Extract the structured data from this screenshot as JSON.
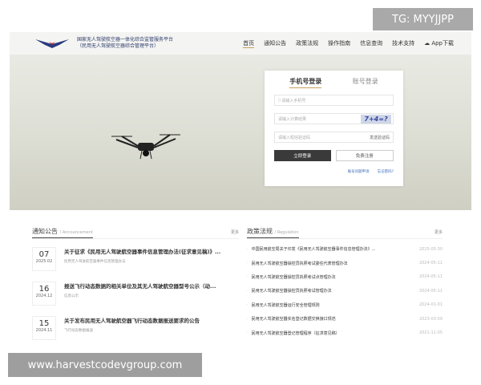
{
  "watermark_top": "TG: MYYJJPP",
  "watermark_bottom": "www.harvestcodevgroup.com",
  "header": {
    "title1": "国家无人驾驶航空器一体化综合监管服务平台",
    "title2": "（民用无人驾驶航空器综合管理平台）",
    "nav": [
      "首页",
      "通知公告",
      "政策法规",
      "操作指南",
      "信息查询",
      "技术支持",
      "App下载"
    ]
  },
  "login": {
    "tab_phone": "手机号登录",
    "tab_account": "账号登录",
    "phone_placeholder": "请输入手机号",
    "calc_placeholder": "请输入计算结果",
    "captcha": "7+4=?",
    "sms_placeholder": "请输入短信验证码",
    "send_code": "发送验证码",
    "login_btn": "立即登录",
    "register_btn": "免费注册",
    "appeal": "账号问题申诉",
    "forgot": "忘记密码?"
  },
  "announcement": {
    "title": "通知公告",
    "subtitle": "/ Announcement",
    "more": "更多",
    "items": [
      {
        "day": "07",
        "ym": "2025.02",
        "title": "关于征求《民用无人驾驶航空器事件信息管理办法(征求意见稿)》...",
        "tag": "民用无人驾驶航空器事件信息管理办法"
      },
      {
        "day": "16",
        "ym": "2024.12",
        "title": "报送飞行动态数据的相关单位及其无人驾驶航空器型号公示（动...",
        "tag": "信息公示"
      },
      {
        "day": "15",
        "ym": "2024.11",
        "title": "关于发布民用无人驾驶航空器飞行动态数据报送要求的公告",
        "tag": "飞行动态数据报送"
      }
    ]
  },
  "regulation": {
    "title": "政策法规",
    "subtitle": "/ Regulation",
    "more": "更多",
    "items": [
      {
        "title": "中国民用航空局关于印发《民用无人驾驶航空器事件信息管理办法》...",
        "date": "2025-05-30"
      },
      {
        "title": "民用无人驾驶航空器操控员执照考试委任代表管理办法",
        "date": "2024-05-11"
      },
      {
        "title": "民用无人驾驶航空器操控员执照考试点管理办法",
        "date": "2024-05-11"
      },
      {
        "title": "民用无人驾驶航空器操控员执照考试管理办法",
        "date": "2024-05-11"
      },
      {
        "title": "民用无人驾驶航空器运行安全管理规则",
        "date": "2024-01-01"
      },
      {
        "title": "民用无人驾驶航空器实名登记数据交换接口规范",
        "date": "2023-03-09"
      },
      {
        "title": "民用无人驾驶航空器登记管理程序（征求意见稿）",
        "date": "2021-11-05"
      }
    ]
  }
}
